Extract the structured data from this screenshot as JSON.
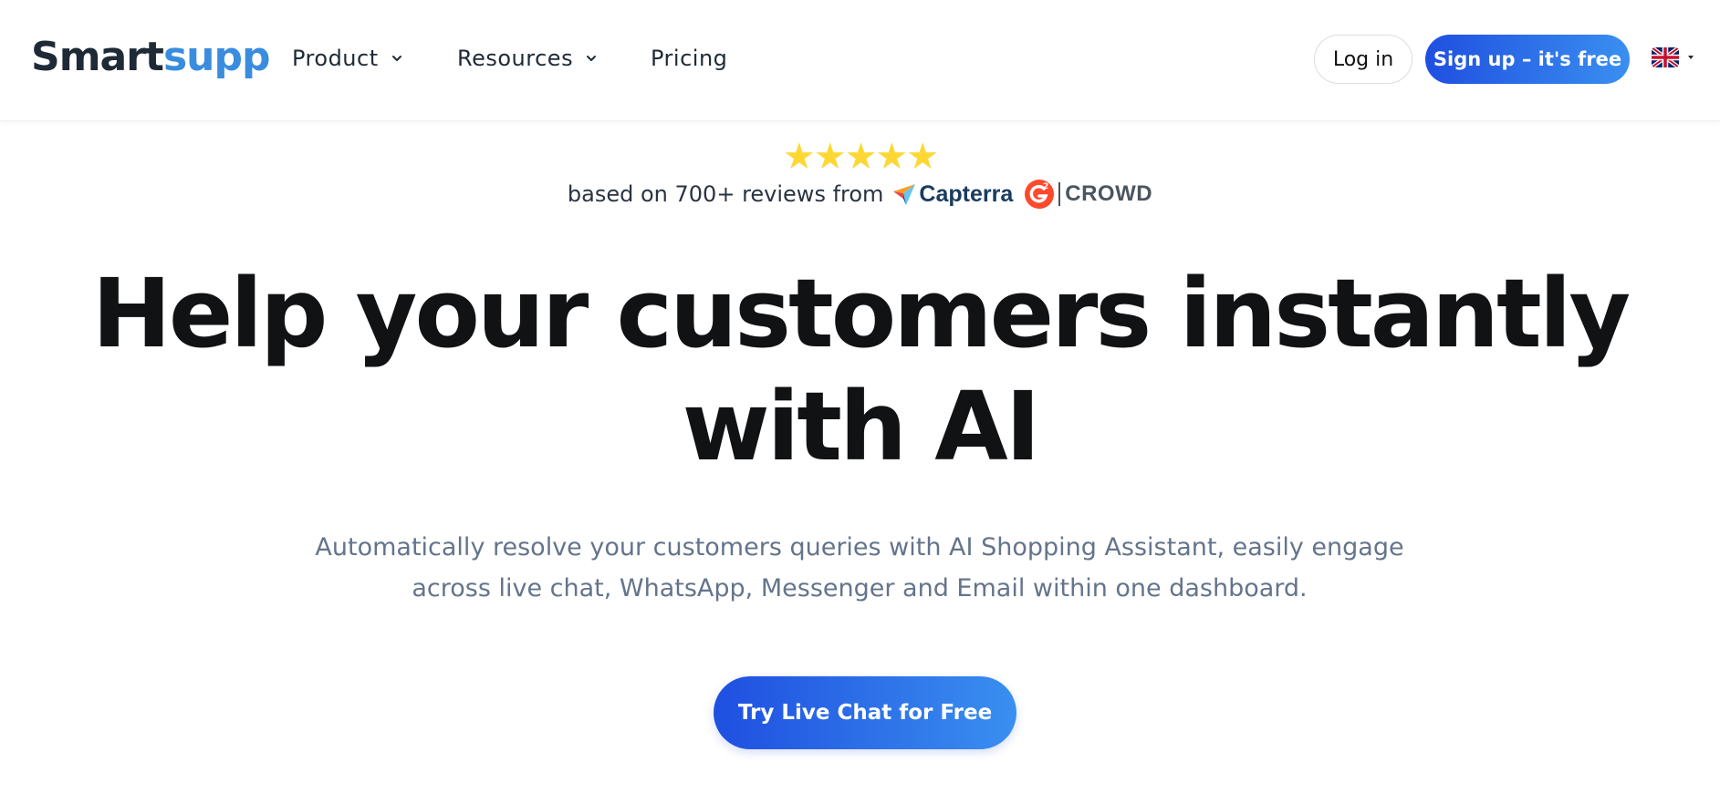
{
  "header": {
    "logo": {
      "part1": "Smart",
      "part2": "supp"
    },
    "nav": [
      {
        "label": "Product",
        "has_dropdown": true
      },
      {
        "label": "Resources",
        "has_dropdown": true
      },
      {
        "label": "Pricing",
        "has_dropdown": false
      }
    ],
    "login_label": "Log in",
    "signup_label": "Sign up – it's free",
    "language_icon": "uk-flag-icon"
  },
  "rating": {
    "stars": "★★★★★",
    "star_count": 5,
    "reviews_text": "based on 700+ reviews from",
    "capterra_label": "Capterra",
    "g2_label": "CROWD"
  },
  "hero": {
    "headline_line1": "Help your customers instantly",
    "headline_line2": "with AI",
    "subtitle_line1": "Automatically resolve your customers queries with AI Shopping Assistant, easily engage",
    "subtitle_line2": "across live chat, WhatsApp, Messenger and Email within one dashboard.",
    "cta_label": "Try Live Chat for Free"
  },
  "colors": {
    "brand_dark": "#1f2a37",
    "brand_blue": "#3a8dde",
    "button_gradient_start": "#1f4fe0",
    "button_gradient_end": "#3a8ff0",
    "star": "#fdd835",
    "subtitle": "#64748b"
  }
}
